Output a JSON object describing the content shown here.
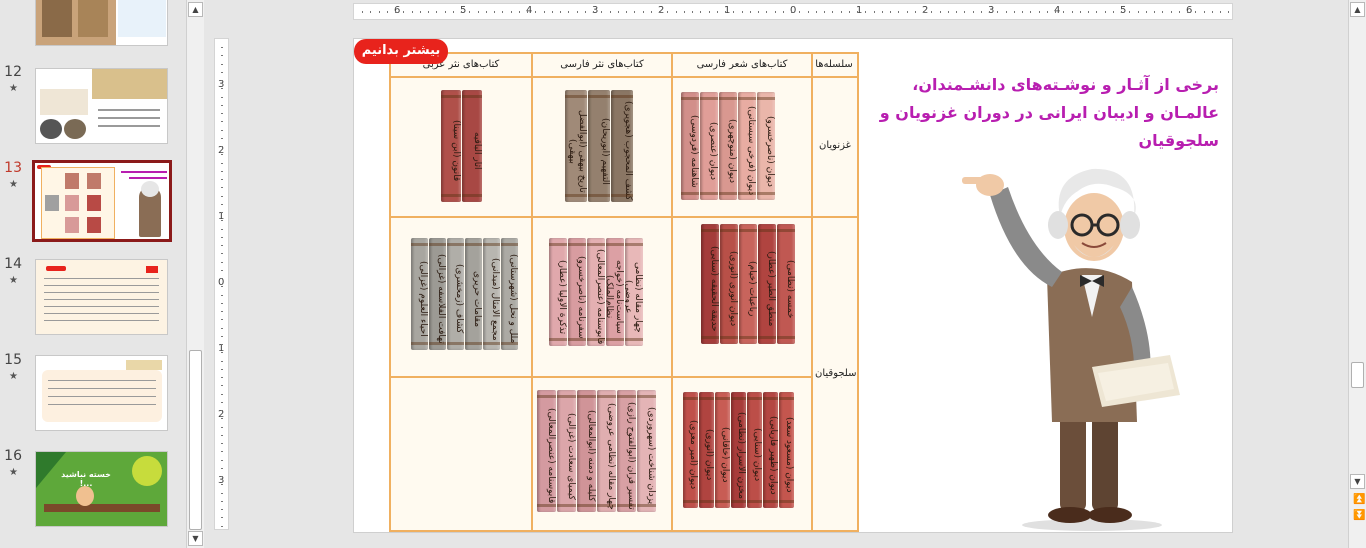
{
  "thumbnails": {
    "slides": [
      {
        "number": "",
        "star": "",
        "active": false
      },
      {
        "number": "12",
        "star": "★",
        "active": false
      },
      {
        "number": "13",
        "star": "★",
        "active": true
      },
      {
        "number": "14",
        "star": "★",
        "active": false
      },
      {
        "number": "15",
        "star": "★",
        "active": false
      },
      {
        "number": "16",
        "star": "★",
        "active": false
      }
    ],
    "slide16_caption": "خسته نباشید ...!"
  },
  "ruler": {
    "h_labels": [
      "6",
      "5",
      "4",
      "3",
      "2",
      "1",
      "0",
      "1",
      "2",
      "3",
      "4",
      "5",
      "6"
    ],
    "v_labels": [
      "3",
      "2",
      "1",
      "0",
      "1",
      "2",
      "3"
    ]
  },
  "slide": {
    "badge": "بیشتر بدانیم",
    "title": "برخی از آثـار و نوشـته‌های دانشـمندان، عالمـان و ادیبان ایرانی در دوران غزنویان و سلجوقیان",
    "table": {
      "headers": [
        "سلسله‌ها",
        "کتاب‌های شعر فارسی",
        "کتاب‌های نثر فارسی",
        "کتاب‌های نثر عربی"
      ],
      "rows": [
        "غزنویان",
        "سلجوقیان"
      ]
    },
    "books": {
      "ghaznavid_poetry": [
        "شاهنامه (فردوسی)",
        "دیوان (عنصری)",
        "دیوان (منوچهری)",
        "دیوان (فرخی سیستانی)",
        "دیوان (ناصرخسرو)"
      ],
      "ghaznavid_prose_fa": [
        "تاریخ بیهقی (ابوالفضل بیهقی)",
        "التفهیم (ابوریحان)",
        "کشف المحجوب (هجویری)"
      ],
      "ghaznavid_prose_ar": [
        "قانون (ابن سینا)",
        "آثار الباقیه"
      ],
      "seljuq_poetry": [
        "حدیقة الحقیقه (سنایی)",
        "دیوان انوری (انوری)",
        "رباعیات (خیام)",
        "منطق الطیر (عطار)",
        "خمسه (نظامی)"
      ],
      "seljuq_prose_fa": [
        "تذکرة الاولیا (عطار)",
        "سفرنامه (ناصرخسرو)",
        "قابوسنامه (عنصرالمعالی)",
        "سیاست‌نامه (خواجه نظام‌الملک)",
        "چهار مقاله (نظامی عروضی)"
      ],
      "seljuq_prose_ar": [
        "احیاء العلوم (غزالی)",
        "تهافت الفلاسفه (غزالی)",
        "کشاف (زمخشری)",
        "مقامات حریری",
        "مجمع الامثال (میدانی)",
        "ملل و نحل (شهرستانی)"
      ],
      "row3_prose_fa": [
        "قابوسنامه (عنصرالمعالی)",
        "کیمیای سعادت (غزالی)",
        "کلیله و دمنه (ابوالمعالی)",
        "چهار مقاله (نظامی عروضی)",
        "تفسیر قرآن (ابوالفتوح رازی)",
        "یزدان شناخت (سهروردی)"
      ],
      "row3_poetry": [
        "دیوان (امیر معزی)",
        "دیوان (انوری)",
        "دیوان (خاقانی)",
        "مخزن الاسرار (نظامی)",
        "دیوان (سنایی)",
        "دیوان (ظهیر فاریابی)",
        "دیوان (مسعود سعد)"
      ]
    }
  },
  "colors": {
    "accent_red": "#e8231c",
    "title_magenta": "#b81eb0",
    "grid_orange": "#f0b060",
    "active_thumb_border": "#8b1a1a"
  }
}
